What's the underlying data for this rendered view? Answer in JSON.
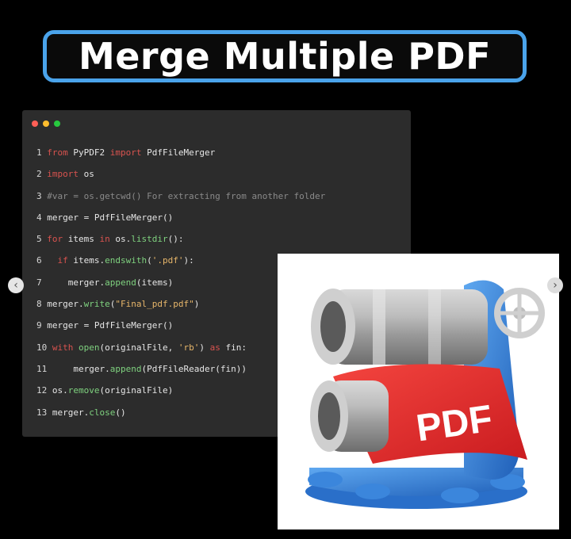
{
  "title": "Merge Multiple PDF",
  "window_dots": [
    {
      "name": "close-dot",
      "color": "#ff5f56"
    },
    {
      "name": "minimize-dot",
      "color": "#ffbd2e"
    },
    {
      "name": "maximize-dot",
      "color": "#27c93f"
    }
  ],
  "code_lines": [
    {
      "num": "1",
      "tokens": [
        {
          "t": "from",
          "c": "kw"
        },
        {
          "t": " PyPDF2 ",
          "c": ""
        },
        {
          "t": "import",
          "c": "kw"
        },
        {
          "t": " PdfFileMerger",
          "c": ""
        }
      ]
    },
    {
      "num": "2",
      "tokens": [
        {
          "t": "import",
          "c": "kw"
        },
        {
          "t": " os",
          "c": ""
        }
      ]
    },
    {
      "num": "3",
      "tokens": [
        {
          "t": "#var = os.getcwd() For extracting from another folder",
          "c": "cm"
        }
      ]
    },
    {
      "num": "4",
      "tokens": [
        {
          "t": "merger = PdfFileMerger()",
          "c": ""
        }
      ]
    },
    {
      "num": "5",
      "tokens": [
        {
          "t": "for",
          "c": "kw"
        },
        {
          "t": " items ",
          "c": ""
        },
        {
          "t": "in",
          "c": "kw"
        },
        {
          "t": " os.",
          "c": ""
        },
        {
          "t": "listdir",
          "c": "fn"
        },
        {
          "t": "():",
          "c": ""
        }
      ]
    },
    {
      "num": "6",
      "tokens": [
        {
          "t": "  ",
          "c": ""
        },
        {
          "t": "if",
          "c": "kw"
        },
        {
          "t": " items.",
          "c": ""
        },
        {
          "t": "endswith",
          "c": "fn"
        },
        {
          "t": "(",
          "c": ""
        },
        {
          "t": "'.pdf'",
          "c": "st"
        },
        {
          "t": "):",
          "c": ""
        }
      ]
    },
    {
      "num": "7",
      "tokens": [
        {
          "t": "    merger.",
          "c": ""
        },
        {
          "t": "append",
          "c": "fn"
        },
        {
          "t": "(items)",
          "c": ""
        }
      ]
    },
    {
      "num": "8",
      "tokens": [
        {
          "t": "merger.",
          "c": ""
        },
        {
          "t": "write",
          "c": "fn"
        },
        {
          "t": "(",
          "c": ""
        },
        {
          "t": "\"Final_pdf.pdf\"",
          "c": "st"
        },
        {
          "t": ")",
          "c": ""
        }
      ]
    },
    {
      "num": "9",
      "tokens": [
        {
          "t": "merger = PdfFileMerger()",
          "c": ""
        }
      ]
    },
    {
      "num": "10",
      "tokens": [
        {
          "t": "with",
          "c": "kw"
        },
        {
          "t": " ",
          "c": ""
        },
        {
          "t": "open",
          "c": "fn"
        },
        {
          "t": "(originalFile, ",
          "c": ""
        },
        {
          "t": "'rb'",
          "c": "st"
        },
        {
          "t": ") ",
          "c": ""
        },
        {
          "t": "as",
          "c": "kw"
        },
        {
          "t": " fin:",
          "c": ""
        }
      ]
    },
    {
      "num": "11",
      "tokens": [
        {
          "t": "    merger.",
          "c": ""
        },
        {
          "t": "append",
          "c": "fn"
        },
        {
          "t": "(PdfFileReader(fin))",
          "c": ""
        }
      ]
    },
    {
      "num": "12",
      "tokens": [
        {
          "t": "os.",
          "c": ""
        },
        {
          "t": "remove",
          "c": "fn"
        },
        {
          "t": "(originalFile)",
          "c": ""
        }
      ]
    },
    {
      "num": "13",
      "tokens": [
        {
          "t": "merger.",
          "c": ""
        },
        {
          "t": "close",
          "c": "fn"
        },
        {
          "t": "()",
          "c": ""
        }
      ]
    }
  ],
  "logo": {
    "label": "PDF",
    "red": "#e8262a",
    "blue": "#2f7fd9"
  },
  "nav": {
    "prev_glyph": "‹",
    "next_glyph": "›"
  }
}
